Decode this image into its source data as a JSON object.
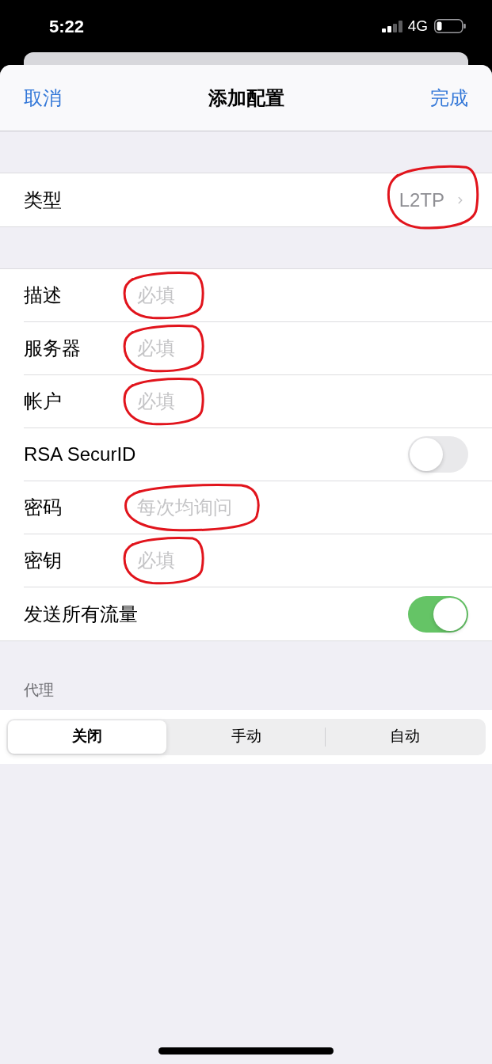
{
  "status_bar": {
    "time": "5:22",
    "network": "4G"
  },
  "nav_bar": {
    "cancel": "取消",
    "title": "添加配置",
    "done": "完成"
  },
  "sections": [
    {
      "rows": [
        {
          "kind": "picker",
          "label": "类型",
          "value": "L2TP",
          "circled": true
        }
      ]
    },
    {
      "rows": [
        {
          "kind": "field",
          "label": "描述",
          "placeholder": "必填",
          "circled": true
        },
        {
          "kind": "field",
          "label": "服务器",
          "placeholder": "必填",
          "circled": true
        },
        {
          "kind": "field",
          "label": "帐户",
          "placeholder": "必填",
          "circled": true
        },
        {
          "kind": "switch",
          "label": "RSA SecurID",
          "on": false
        },
        {
          "kind": "field",
          "label": "密码",
          "placeholder": "每次均询问",
          "circled": true
        },
        {
          "kind": "field",
          "label": "密钥",
          "placeholder": "必填",
          "circled": true
        },
        {
          "kind": "switch",
          "label": "发送所有流量",
          "on": true
        }
      ]
    }
  ],
  "proxy": {
    "header": "代理",
    "segments": [
      {
        "label": "关闭",
        "selected": true
      },
      {
        "label": "手动",
        "selected": false
      },
      {
        "label": "自动",
        "selected": false
      }
    ]
  }
}
